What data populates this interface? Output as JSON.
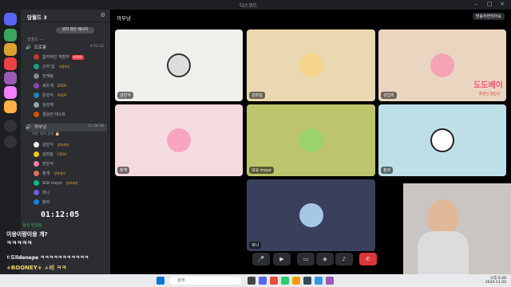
{
  "window": {
    "title": "디스코드"
  },
  "server": {
    "name": "당월드 3"
  },
  "sidebar": {
    "unread_label": "읽지 않은 메시지",
    "category": "당월드 —",
    "channels": [
      {
        "label": "도로롱",
        "time": "4:41:32"
      },
      {
        "label": "까부냥",
        "time": "11:34:38"
      }
    ],
    "members_top": [
      {
        "name": "합리적인 개발자",
        "tag": "라이브"
      },
      {
        "name": "근야 집",
        "tag": "고용보는"
      },
      {
        "name": "전캐림"
      },
      {
        "name": "세츠계",
        "tag": "SOOP"
      },
      {
        "name": "문상익",
        "tag": "SOOP"
      },
      {
        "name": "김성재"
      },
      {
        "name": "결승전 테스트"
      }
    ],
    "status_line": "모든 것이 공손 🎂",
    "members_bottom": [
      {
        "name": "강민식",
        "tag": "강좌세가"
      },
      {
        "name": "김마늘",
        "tag": "CROA"
      },
      {
        "name": "전민석"
      },
      {
        "name": "창개",
        "tag": "강좌세가"
      },
      {
        "name": "모요 moyo",
        "tag": "강좌세가"
      },
      {
        "name": "파니"
      },
      {
        "name": "참와"
      }
    ]
  },
  "stage": {
    "channel_name": "까부냥",
    "top_right": "방송하면되어요",
    "tiles": [
      {
        "name": "강민식",
        "bg": "#f0efec"
      },
      {
        "name": "김마늘",
        "bg": "#ead9b0"
      },
      {
        "name": "강입비",
        "bg": "#ead6c0"
      },
      {
        "name": "창개",
        "bg": "#f4dbe0"
      },
      {
        "name": "모요 moyo",
        "bg": "#bcc56b"
      },
      {
        "name": "참와",
        "bg": "#bfdfe8"
      },
      {
        "name": "파니",
        "bg": "#3a3f5c"
      }
    ],
    "brand_overlay": "도도베이",
    "brand_sub": "후원인 김민식"
  },
  "overlay": {
    "timer": "01:12:05",
    "voice_label": "음성 연결됨",
    "chat_1": "이응이랑이응 개?",
    "chat_2": "ㅋㅋㅋㅋㅋ",
    "chat_3": "ㄷ도lldenepe ㅋㅋㅋㅋㅋㅋㅋㅋㅋㅋㅋ",
    "chat_4": "+ROONEY+ ㅅ비 ㅋㅋ"
  },
  "taskbar": {
    "search_placeholder": "검색",
    "time": "오후 6:28",
    "date": "2024-11-20"
  }
}
